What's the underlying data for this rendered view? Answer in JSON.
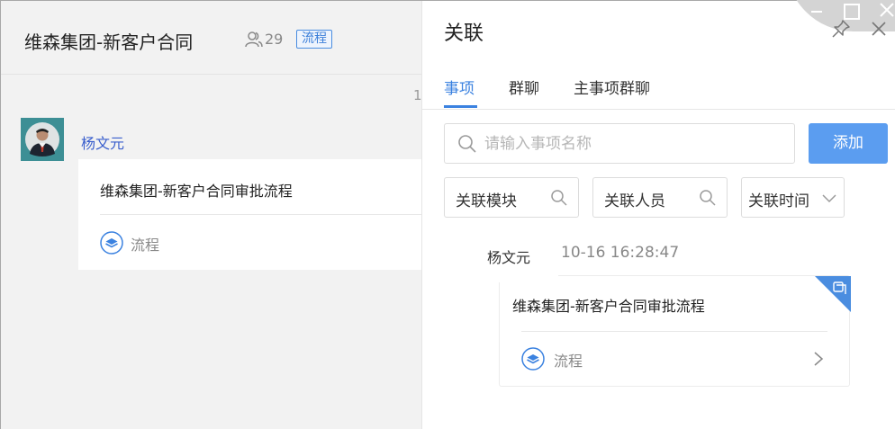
{
  "chat": {
    "title": "维森集团-新客户合同",
    "member_count": "29",
    "tag": "流程",
    "time_stub": "1",
    "sender": "杨文元",
    "message": {
      "title": "维森集团-新客户合同审批流程",
      "type": "流程"
    }
  },
  "panel": {
    "title": "关联",
    "tabs": [
      {
        "label": "事项",
        "active": true
      },
      {
        "label": "群聊",
        "active": false
      },
      {
        "label": "主事项群聊",
        "active": false
      }
    ],
    "search": {
      "placeholder": "请输入事项名称",
      "value": ""
    },
    "add_label": "添加",
    "filters": [
      {
        "label": "关联模块",
        "icon": "search-icon"
      },
      {
        "label": "关联人员",
        "icon": "search-icon"
      },
      {
        "label": "关联时间",
        "icon": "chevron-down-icon"
      }
    ],
    "result": {
      "popup_name": "杨文元",
      "time": "10-16 16:28:47",
      "title": "维森集团-新客户合同审批流程",
      "type": "流程"
    }
  },
  "colors": {
    "accent": "#3b82e0",
    "add_button": "#5b9df0",
    "sender_name": "#3a5fcd"
  }
}
